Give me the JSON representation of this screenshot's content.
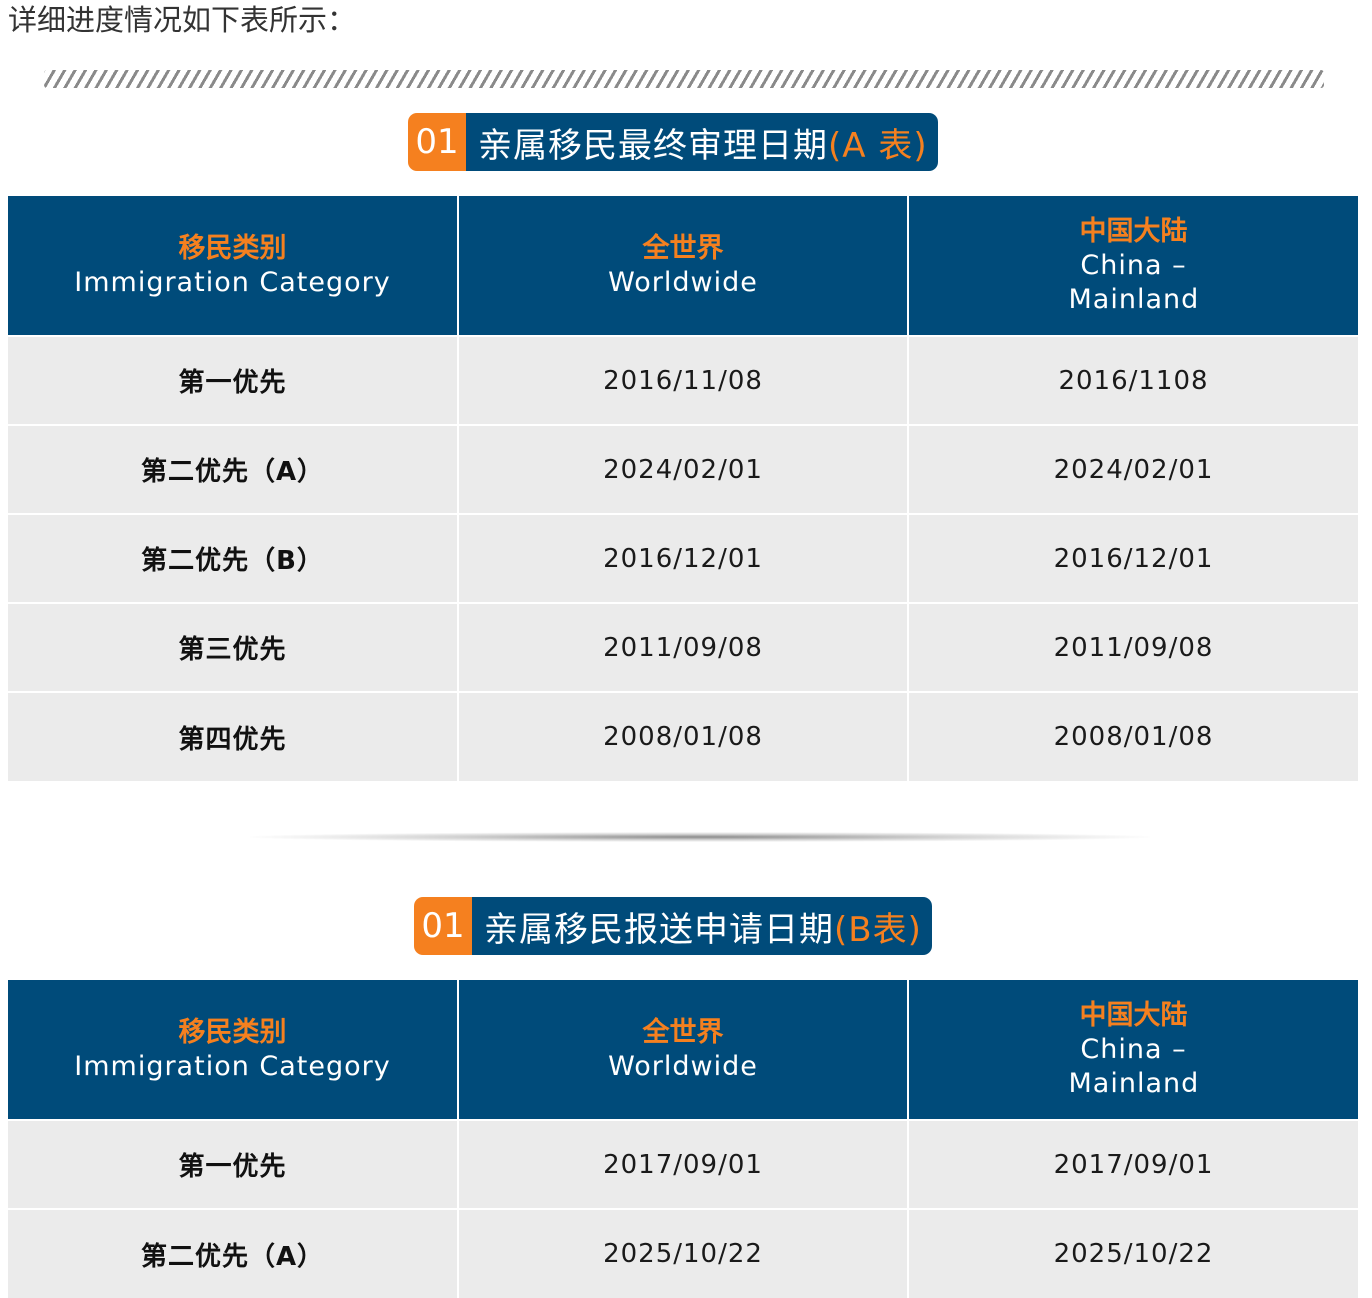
{
  "intro_text": "详细进度情况如下表所示：",
  "colors": {
    "navy": "#004b7a",
    "orange": "#f5801f",
    "row_bg": "#ebebeb"
  },
  "headers": {
    "category_zh": "移民类别",
    "category_en": "Immigration Category",
    "worldwide_zh": "全世界",
    "worldwide_en": "Worldwide",
    "china_zh": "中国大陆",
    "china_en": "China – Mainland"
  },
  "table_a": {
    "number": "01",
    "title": "亲属移民最终审理日期",
    "suffix": "(A 表)",
    "rows": [
      {
        "category": "第一优先",
        "worldwide": "2016/11/08",
        "china": "2016/1108"
      },
      {
        "category": "第二优先（A）",
        "worldwide": "2024/02/01",
        "china": "2024/02/01"
      },
      {
        "category": "第二优先（B）",
        "worldwide": "2016/12/01",
        "china": "2016/12/01"
      },
      {
        "category": "第三优先",
        "worldwide": "2011/09/08",
        "china": "2011/09/08"
      },
      {
        "category": "第四优先",
        "worldwide": "2008/01/08",
        "china": "2008/01/08"
      }
    ]
  },
  "table_b": {
    "number": "01",
    "title": "亲属移民报送申请日期",
    "suffix": "(B表)",
    "rows": [
      {
        "category": "第一优先",
        "worldwide": "2017/09/01",
        "china": "2017/09/01"
      },
      {
        "category": "第二优先（A）",
        "worldwide": "2025/10/22",
        "china": "2025/10/22"
      }
    ]
  }
}
